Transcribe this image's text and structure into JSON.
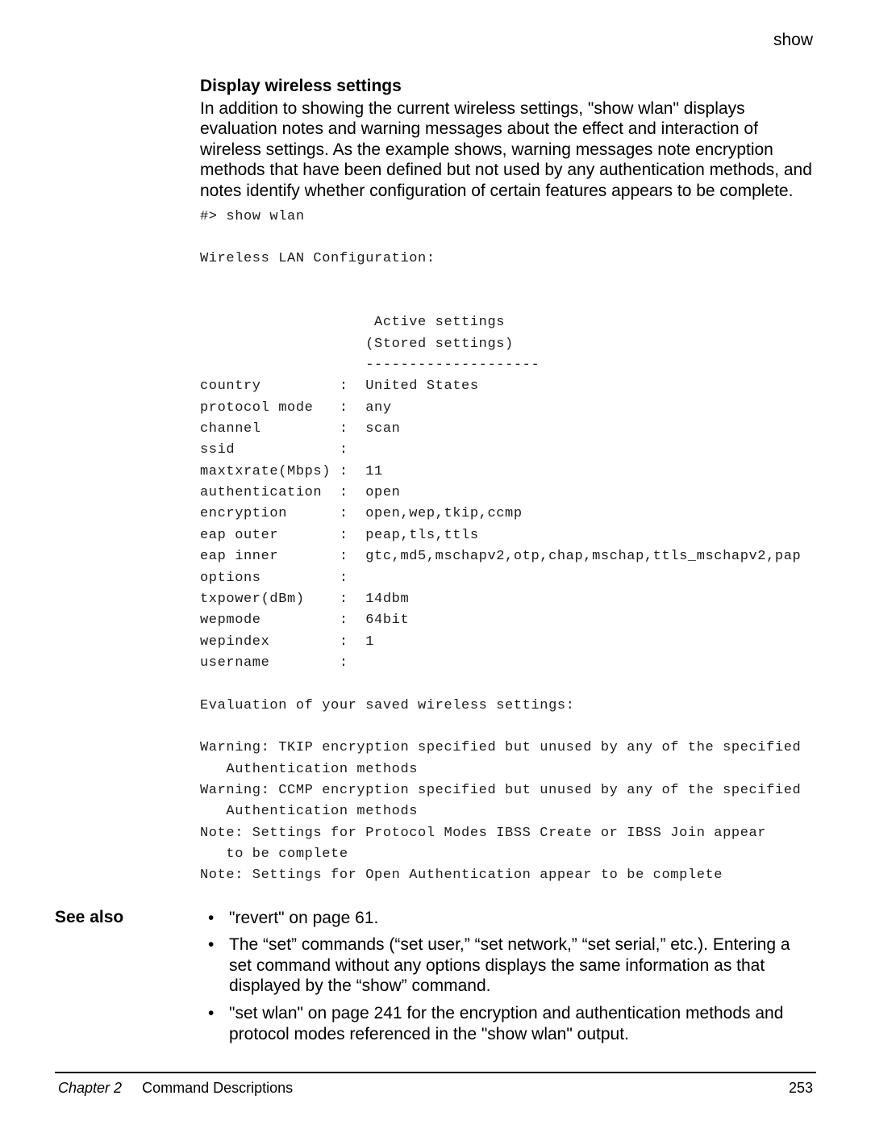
{
  "header": {
    "title": "show"
  },
  "section": {
    "subheading": "Display wireless settings",
    "paragraph": "In addition to showing the current wireless settings, \"show wlan\" displays evaluation notes and warning messages about the effect and interaction of wireless settings. As the example shows, warning messages note encryption methods that have been defined but not used by any authentication methods, and notes identify whether configuration of certain features appears to be complete."
  },
  "code": "#> show wlan\n\nWireless LAN Configuration:\n\n\n                    Active settings\n                   (Stored settings)\n                   --------------------\ncountry         :  United States\nprotocol mode   :  any\nchannel         :  scan\nssid            :\nmaxtxrate(Mbps) :  11\nauthentication  :  open\nencryption      :  open,wep,tkip,ccmp\neap outer       :  peap,tls,ttls\neap inner       :  gtc,md5,mschapv2,otp,chap,mschap,ttls_mschapv2,pap\noptions         :\ntxpower(dBm)    :  14dbm\nwepmode         :  64bit\nwepindex        :  1\nusername        :\n\nEvaluation of your saved wireless settings:\n\nWarning: TKIP encryption specified but unused by any of the specified\n   Authentication methods\nWarning: CCMP encryption specified but unused by any of the specified\n   Authentication methods\nNote: Settings for Protocol Modes IBSS Create or IBSS Join appear\n   to be complete\nNote: Settings for Open Authentication appear to be complete",
  "see_also": {
    "label": "See also",
    "items": [
      "\"revert\" on page 61.",
      "The “set” commands (“set user,” “set network,” “set serial,” etc.). Entering a set command without any options displays the same information as that displayed by the “show” command.",
      "\"set wlan\" on page 241 for the encryption and authentication methods and protocol modes referenced in the \"show wlan\" output."
    ]
  },
  "footer": {
    "chapter_label": "Chapter 2",
    "chapter_title": "Command Descriptions",
    "page_number": "253"
  }
}
